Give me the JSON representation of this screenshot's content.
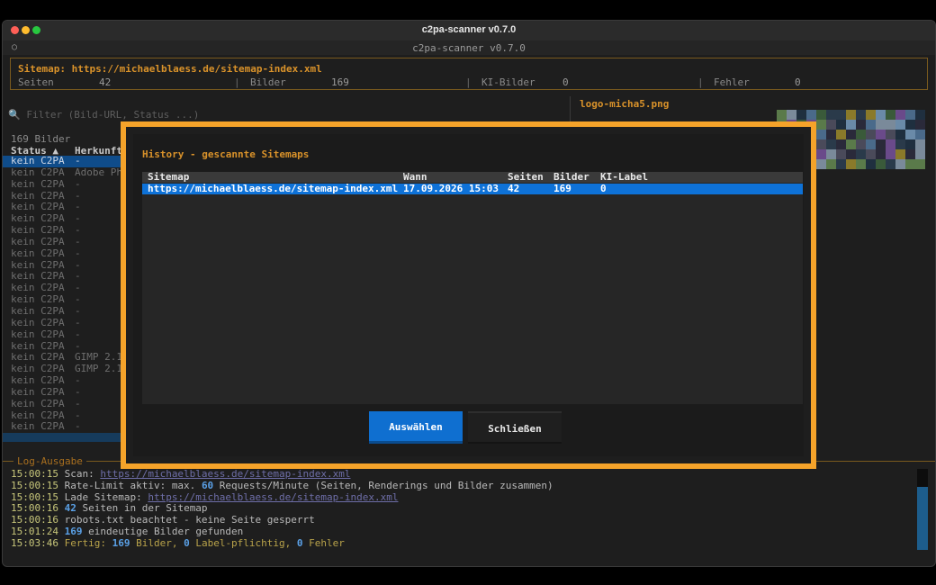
{
  "window": {
    "title": "c2pa-scanner v0.7.0",
    "app_title": "c2pa-scanner v0.7.0"
  },
  "summary": {
    "title": "Sitemap: https://michaelblaess.de/sitemap-index.xml",
    "stats": [
      {
        "label": "Seiten",
        "value": "42"
      },
      {
        "label": "Bilder",
        "value": "169"
      },
      {
        "label": "KI-Bilder",
        "value": "0"
      },
      {
        "label": "Fehler",
        "value": "0"
      }
    ]
  },
  "filter": {
    "placeholder": "Filter (Bild-URL, Status ...)"
  },
  "table": {
    "count": "169 Bilder",
    "headers": [
      "Status ▲",
      "Herkunft"
    ],
    "rows": [
      [
        "kein C2PA",
        "-"
      ],
      [
        "kein C2PA",
        "Adobe Ph"
      ],
      [
        "kein C2PA",
        "-"
      ],
      [
        "kein C2PA",
        "-"
      ],
      [
        "kein C2PA",
        "-"
      ],
      [
        "kein C2PA",
        "-"
      ],
      [
        "kein C2PA",
        "-"
      ],
      [
        "kein C2PA",
        "-"
      ],
      [
        "kein C2PA",
        "-"
      ],
      [
        "kein C2PA",
        "-"
      ],
      [
        "kein C2PA",
        "-"
      ],
      [
        "kein C2PA",
        "-"
      ],
      [
        "kein C2PA",
        "-"
      ],
      [
        "kein C2PA",
        "-"
      ],
      [
        "kein C2PA",
        "-"
      ],
      [
        "kein C2PA",
        "-"
      ],
      [
        "kein C2PA",
        "-"
      ],
      [
        "kein C2PA",
        "GIMP 2.1"
      ],
      [
        "kein C2PA",
        "GIMP 2.1"
      ],
      [
        "kein C2PA",
        "-"
      ],
      [
        "kein C2PA",
        "-"
      ],
      [
        "kein C2PA",
        "-"
      ],
      [
        "kein C2PA",
        "-"
      ],
      [
        "kein C2PA",
        "-"
      ]
    ]
  },
  "preview": {
    "title": "logo-micha5.png"
  },
  "log": {
    "label": "Log-Ausgabe",
    "lines": [
      {
        "ts": "15:00:15",
        "parts": [
          {
            "t": "text",
            "v": " Scan: "
          },
          {
            "t": "url",
            "v": "https://michaelblaess.de/sitemap-index.xml"
          }
        ]
      },
      {
        "ts": "15:00:15",
        "parts": [
          {
            "t": "text",
            "v": " Rate-Limit aktiv: max. "
          },
          {
            "t": "num",
            "v": "60"
          },
          {
            "t": "text",
            "v": " Requests/Minute (Seiten, Renderings und Bilder zusammen)"
          }
        ]
      },
      {
        "ts": "15:00:15",
        "parts": [
          {
            "t": "text",
            "v": " Lade Sitemap: "
          },
          {
            "t": "url",
            "v": "https://michaelblaess.de/sitemap-index.xml"
          }
        ]
      },
      {
        "ts": "15:00:16",
        "parts": [
          {
            "t": "text",
            "v": " "
          },
          {
            "t": "num",
            "v": "42"
          },
          {
            "t": "text",
            "v": " Seiten in der Sitemap"
          }
        ]
      },
      {
        "ts": "15:00:16",
        "parts": [
          {
            "t": "text",
            "v": " robots.txt beachtet - keine Seite gesperrt"
          }
        ]
      },
      {
        "ts": "15:01:24",
        "parts": [
          {
            "t": "text",
            "v": " "
          },
          {
            "t": "num",
            "v": "169"
          },
          {
            "t": "text",
            "v": " eindeutige Bilder gefunden"
          }
        ]
      },
      {
        "ts": "15:03:46",
        "final": true,
        "parts": [
          {
            "t": "text",
            "v": " Fertig: "
          },
          {
            "t": "num",
            "v": "169"
          },
          {
            "t": "text",
            "v": " Bilder, "
          },
          {
            "t": "num",
            "v": "0"
          },
          {
            "t": "text",
            "v": " Label-pflichtig, "
          },
          {
            "t": "num",
            "v": "0"
          },
          {
            "t": "text",
            "v": " Fehler"
          }
        ]
      }
    ]
  },
  "modal": {
    "title": "History - gescannte Sitemaps",
    "headers": [
      "Sitemap",
      "Wann",
      "Seiten",
      "Bilder",
      "KI-Label"
    ],
    "rows": [
      [
        "https://michaelblaess.de/sitemap-index.xml",
        "17.09.2026 15:03",
        "42",
        "169",
        "0"
      ]
    ],
    "select_label": "Auswählen",
    "close_label": "Schließen"
  },
  "colors": {
    "accent": "#f5a32a",
    "selection": "#0e72d8",
    "primary_button": "#0f6fd0"
  }
}
